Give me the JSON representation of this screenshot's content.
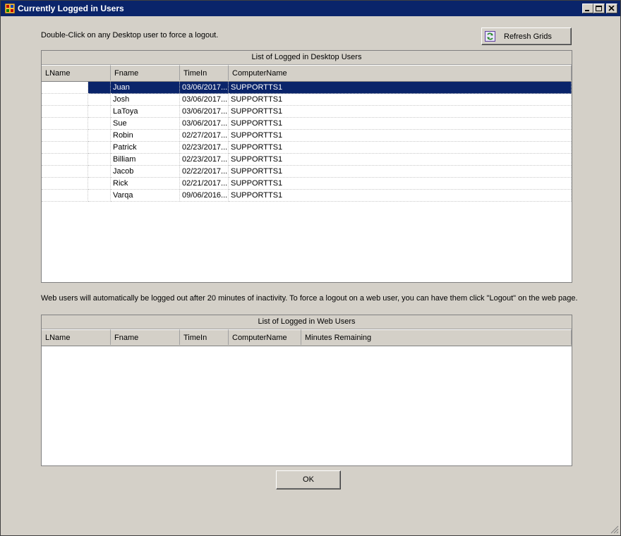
{
  "window": {
    "title": "Currently Logged in Users"
  },
  "instructions": "Double-Click on any Desktop user to force a logout.",
  "refresh_button": {
    "label": "Refresh Grids"
  },
  "desktop_grid": {
    "caption": "List of Logged in Desktop Users",
    "columns": [
      "LName",
      "Fname",
      "TimeIn",
      "ComputerName"
    ],
    "rows": [
      {
        "lname": "",
        "fname": "Juan",
        "timein": "03/06/2017...",
        "computer": "SUPPORTTS1"
      },
      {
        "lname": "",
        "fname": "Josh",
        "timein": "03/06/2017...",
        "computer": "SUPPORTTS1"
      },
      {
        "lname": "",
        "fname": "LaToya",
        "timein": "03/06/2017...",
        "computer": "SUPPORTTS1"
      },
      {
        "lname": "",
        "fname": "Sue",
        "timein": "03/06/2017...",
        "computer": "SUPPORTTS1"
      },
      {
        "lname": "",
        "fname": "Robin",
        "timein": "02/27/2017...",
        "computer": "SUPPORTTS1"
      },
      {
        "lname": "",
        "fname": "Patrick",
        "timein": "02/23/2017...",
        "computer": "SUPPORTTS1"
      },
      {
        "lname": "",
        "fname": "Billiam",
        "timein": "02/23/2017...",
        "computer": "SUPPORTTS1"
      },
      {
        "lname": "",
        "fname": "Jacob",
        "timein": "02/22/2017...",
        "computer": "SUPPORTTS1"
      },
      {
        "lname": "",
        "fname": "Rick",
        "timein": "02/21/2017...",
        "computer": "SUPPORTTS1"
      },
      {
        "lname": "",
        "fname": "Varqa",
        "timein": "09/06/2016...",
        "computer": "SUPPORTTS1"
      }
    ],
    "selected_row": 0
  },
  "web_note": "Web users will automatically be logged out after 20 minutes of inactivity.  To force a logout on a web user, you can have them click \"Logout\" on the web page.",
  "web_grid": {
    "caption": "List of Logged in Web Users",
    "columns": [
      "LName",
      "Fname",
      "TimeIn",
      "ComputerName",
      "Minutes Remaining"
    ],
    "rows": []
  },
  "ok_button": {
    "label": "OK"
  },
  "icons": {
    "app": "app-icon",
    "refresh": "refresh-icon",
    "minimize": "minimize-icon",
    "maximize": "maximize-icon",
    "close": "close-icon"
  }
}
